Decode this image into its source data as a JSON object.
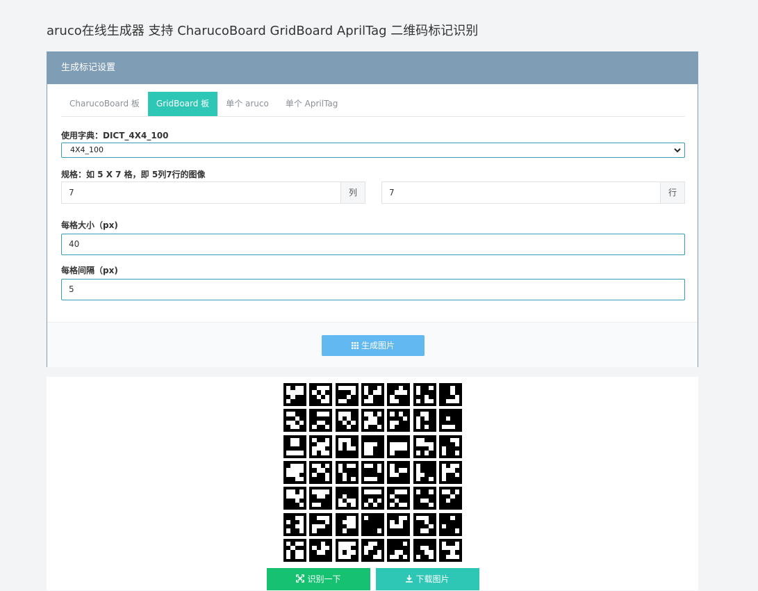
{
  "page": {
    "title": "aruco在线生成器 支持 CharucoBoard GridBoard AprilTag 二维码标记识别"
  },
  "panel": {
    "header": "生成标记设置",
    "tabs": [
      {
        "label": "CharucoBoard 板",
        "active": false
      },
      {
        "label": "GridBoard 板",
        "active": true
      },
      {
        "label": "单个 aruco",
        "active": false
      },
      {
        "label": "单个 AprilTag",
        "active": false
      }
    ],
    "dictionary": {
      "label": "使用字典：DICT_4X4_100",
      "selected": "4X4_100",
      "icon": "chevron-down-icon"
    },
    "size": {
      "label": "规格：如 5 X 7 格，即 5列7行的图像",
      "cols_value": "7",
      "cols_unit": "列",
      "rows_value": "7",
      "rows_unit": "行"
    },
    "cell_size": {
      "label": "每格大小（px)",
      "value": "40"
    },
    "cell_gap": {
      "label": "每格间隔（px)",
      "value": "5"
    },
    "generate_button": {
      "label": "生成图片",
      "icon": "grid-icon"
    }
  },
  "result": {
    "board": {
      "rows": 7,
      "cols": 7
    },
    "recognize_button": {
      "label": "识别一下",
      "icon": "scan-icon",
      "color": "#16c172"
    },
    "download_button": {
      "label": "下载图片",
      "icon": "download-icon",
      "color": "#2ec7b6"
    }
  },
  "colors": {
    "accent": "#2ec7b6",
    "header": "#7f9db4",
    "generate": "#62b8f0"
  }
}
